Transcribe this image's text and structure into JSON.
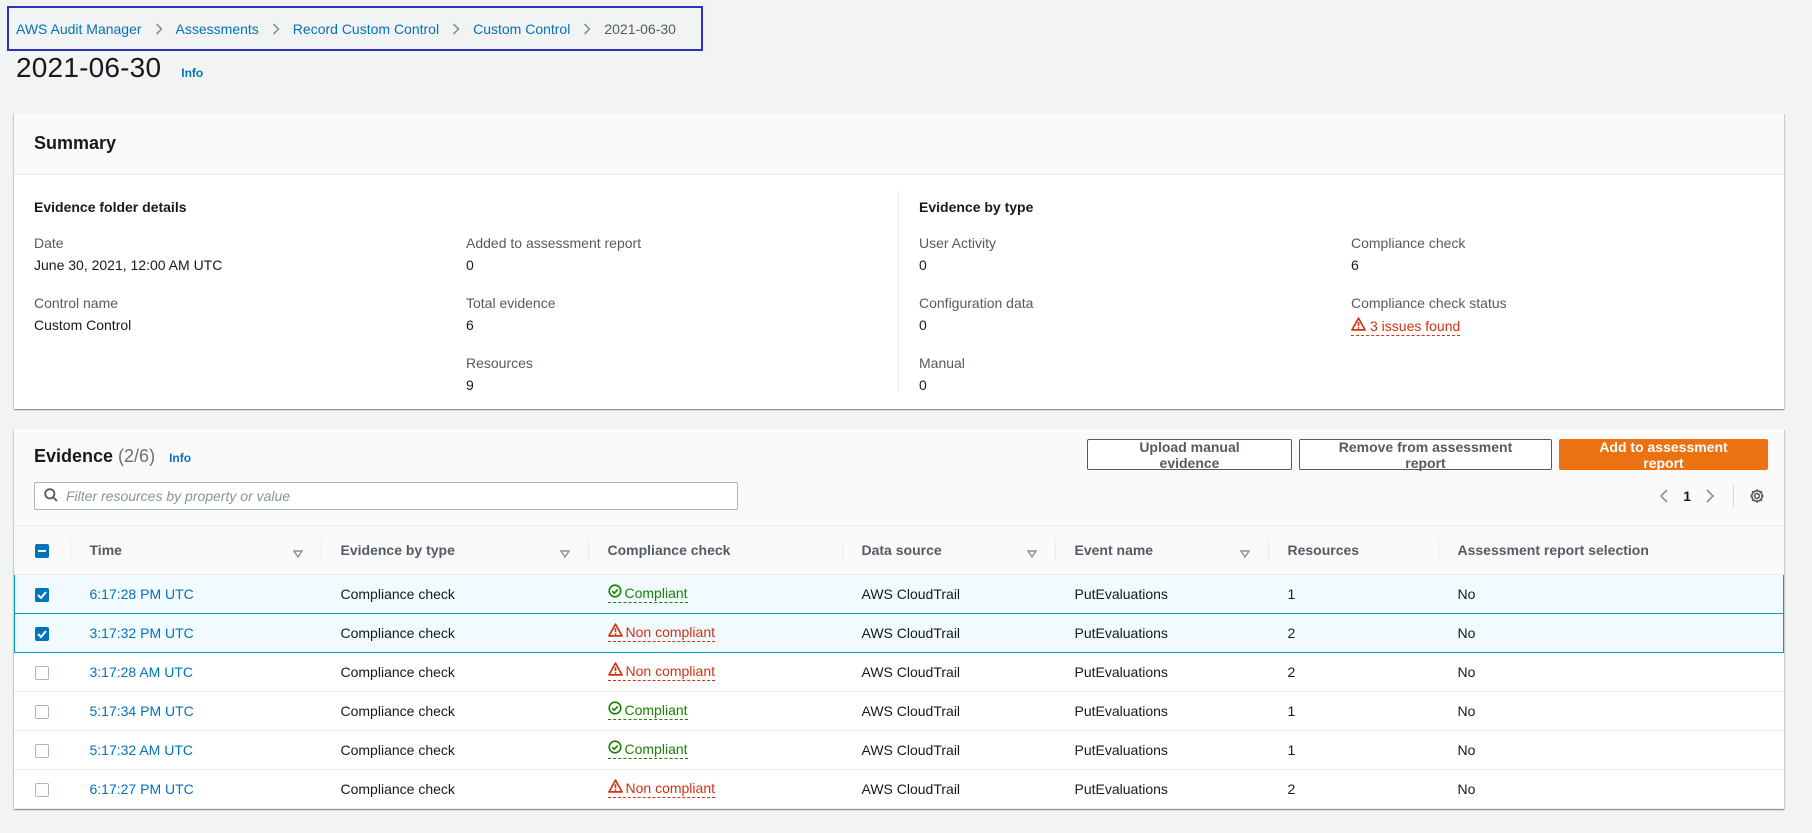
{
  "breadcrumb": [
    "AWS Audit Manager",
    "Assessments",
    "Record Custom Control",
    "Custom Control",
    "2021-06-30"
  ],
  "page": {
    "title": "2021-06-30",
    "info": "Info"
  },
  "summary": {
    "title": "Summary",
    "folder": {
      "title": "Evidence folder details",
      "date_label": "Date",
      "date_value": "June 30, 2021, 12:00 AM UTC",
      "control_label": "Control name",
      "control_value": "Custom Control",
      "added_label": "Added to assessment report",
      "added_value": "0",
      "total_label": "Total evidence",
      "total_value": "6",
      "resources_label": "Resources",
      "resources_value": "9"
    },
    "by_type": {
      "title": "Evidence by type",
      "user_label": "User Activity",
      "user_value": "0",
      "config_label": "Configuration data",
      "config_value": "0",
      "manual_label": "Manual",
      "manual_value": "0",
      "compliance_label": "Compliance check",
      "compliance_value": "6",
      "status_label": "Compliance check status",
      "status_value": "3 issues found"
    }
  },
  "evidence": {
    "title": "Evidence",
    "count": "(2/6)",
    "info": "Info",
    "upload_label": "Upload manual evidence",
    "remove_label": "Remove from assessment report",
    "add_label": "Add to assessment report",
    "filter_placeholder": "Filter resources by property or value",
    "page": "1",
    "columns": [
      "Time",
      "Evidence by type",
      "Compliance check",
      "Data source",
      "Event name",
      "Resources",
      "Assessment report selection"
    ],
    "rows": [
      {
        "selected": true,
        "time": "6:17:28 PM UTC",
        "type": "Compliance check",
        "compliance": "Compliant",
        "ok": true,
        "source": "AWS CloudTrail",
        "event": "PutEvaluations",
        "resources": "1",
        "selection": "No"
      },
      {
        "selected": true,
        "time": "3:17:32 PM UTC",
        "type": "Compliance check",
        "compliance": "Non compliant",
        "ok": false,
        "source": "AWS CloudTrail",
        "event": "PutEvaluations",
        "resources": "2",
        "selection": "No"
      },
      {
        "selected": false,
        "time": "3:17:28 AM UTC",
        "type": "Compliance check",
        "compliance": "Non compliant",
        "ok": false,
        "source": "AWS CloudTrail",
        "event": "PutEvaluations",
        "resources": "2",
        "selection": "No"
      },
      {
        "selected": false,
        "time": "5:17:34 PM UTC",
        "type": "Compliance check",
        "compliance": "Compliant",
        "ok": true,
        "source": "AWS CloudTrail",
        "event": "PutEvaluations",
        "resources": "1",
        "selection": "No"
      },
      {
        "selected": false,
        "time": "5:17:32 AM UTC",
        "type": "Compliance check",
        "compliance": "Compliant",
        "ok": true,
        "source": "AWS CloudTrail",
        "event": "PutEvaluations",
        "resources": "1",
        "selection": "No"
      },
      {
        "selected": false,
        "time": "6:17:27 PM UTC",
        "type": "Compliance check",
        "compliance": "Non compliant",
        "ok": false,
        "source": "AWS CloudTrail",
        "event": "PutEvaluations",
        "resources": "2",
        "selection": "No"
      }
    ]
  }
}
